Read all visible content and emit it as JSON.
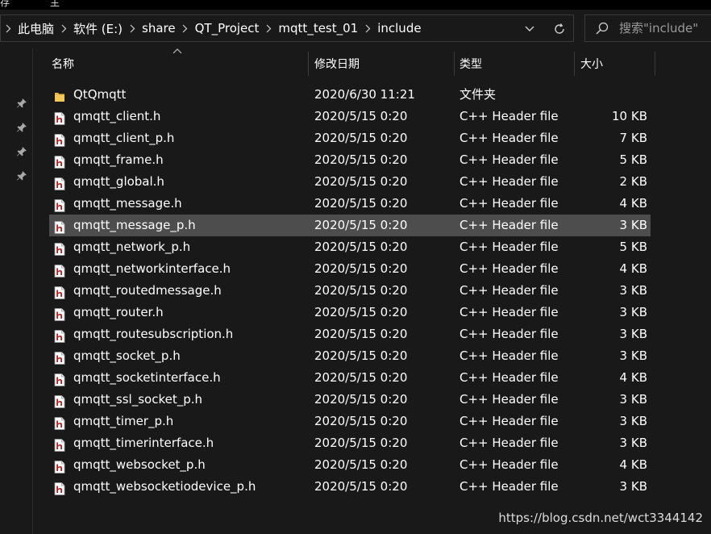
{
  "ribbon": {
    "fragments": [
      "存",
      "主"
    ]
  },
  "address": {
    "crumbs": [
      "此电脑",
      "软件 (E:)",
      "share",
      "QT_Project",
      "mqtt_test_01",
      "include"
    ]
  },
  "search": {
    "placeholder": "搜索\"include\""
  },
  "columns": {
    "name": "名称",
    "date": "修改日期",
    "type": "类型",
    "size": "大小"
  },
  "files": [
    {
      "name": "QtQmqtt",
      "date": "2020/6/30 11:21",
      "type": "文件夹",
      "size": "",
      "icon": "folder-icon"
    },
    {
      "name": "qmqtt_client.h",
      "date": "2020/5/15 0:20",
      "type": "C++ Header file",
      "size": "10 KB",
      "icon": "header-file-icon"
    },
    {
      "name": "qmqtt_client_p.h",
      "date": "2020/5/15 0:20",
      "type": "C++ Header file",
      "size": "7 KB",
      "icon": "header-file-icon"
    },
    {
      "name": "qmqtt_frame.h",
      "date": "2020/5/15 0:20",
      "type": "C++ Header file",
      "size": "5 KB",
      "icon": "header-file-icon"
    },
    {
      "name": "qmqtt_global.h",
      "date": "2020/5/15 0:20",
      "type": "C++ Header file",
      "size": "2 KB",
      "icon": "header-file-icon"
    },
    {
      "name": "qmqtt_message.h",
      "date": "2020/5/15 0:20",
      "type": "C++ Header file",
      "size": "4 KB",
      "icon": "header-file-icon"
    },
    {
      "name": "qmqtt_message_p.h",
      "date": "2020/5/15 0:20",
      "type": "C++ Header file",
      "size": "3 KB",
      "icon": "header-file-icon",
      "selected": true
    },
    {
      "name": "qmqtt_network_p.h",
      "date": "2020/5/15 0:20",
      "type": "C++ Header file",
      "size": "5 KB",
      "icon": "header-file-icon"
    },
    {
      "name": "qmqtt_networkinterface.h",
      "date": "2020/5/15 0:20",
      "type": "C++ Header file",
      "size": "4 KB",
      "icon": "header-file-icon"
    },
    {
      "name": "qmqtt_routedmessage.h",
      "date": "2020/5/15 0:20",
      "type": "C++ Header file",
      "size": "3 KB",
      "icon": "header-file-icon"
    },
    {
      "name": "qmqtt_router.h",
      "date": "2020/5/15 0:20",
      "type": "C++ Header file",
      "size": "3 KB",
      "icon": "header-file-icon"
    },
    {
      "name": "qmqtt_routesubscription.h",
      "date": "2020/5/15 0:20",
      "type": "C++ Header file",
      "size": "3 KB",
      "icon": "header-file-icon"
    },
    {
      "name": "qmqtt_socket_p.h",
      "date": "2020/5/15 0:20",
      "type": "C++ Header file",
      "size": "3 KB",
      "icon": "header-file-icon"
    },
    {
      "name": "qmqtt_socketinterface.h",
      "date": "2020/5/15 0:20",
      "type": "C++ Header file",
      "size": "4 KB",
      "icon": "header-file-icon"
    },
    {
      "name": "qmqtt_ssl_socket_p.h",
      "date": "2020/5/15 0:20",
      "type": "C++ Header file",
      "size": "3 KB",
      "icon": "header-file-icon"
    },
    {
      "name": "qmqtt_timer_p.h",
      "date": "2020/5/15 0:20",
      "type": "C++ Header file",
      "size": "3 KB",
      "icon": "header-file-icon"
    },
    {
      "name": "qmqtt_timerinterface.h",
      "date": "2020/5/15 0:20",
      "type": "C++ Header file",
      "size": "3 KB",
      "icon": "header-file-icon"
    },
    {
      "name": "qmqtt_websocket_p.h",
      "date": "2020/5/15 0:20",
      "type": "C++ Header file",
      "size": "4 KB",
      "icon": "header-file-icon"
    },
    {
      "name": "qmqtt_websocketiodevice_p.h",
      "date": "2020/5/15 0:20",
      "type": "C++ Header file",
      "size": "3 KB",
      "icon": "header-file-icon"
    }
  ],
  "watermark": "https://blog.csdn.net/wct3344142",
  "colors": {
    "background": "#191919",
    "selected_row": "#4d4d4d",
    "folder": "#e8b84a",
    "header_icon": "#b22222"
  }
}
